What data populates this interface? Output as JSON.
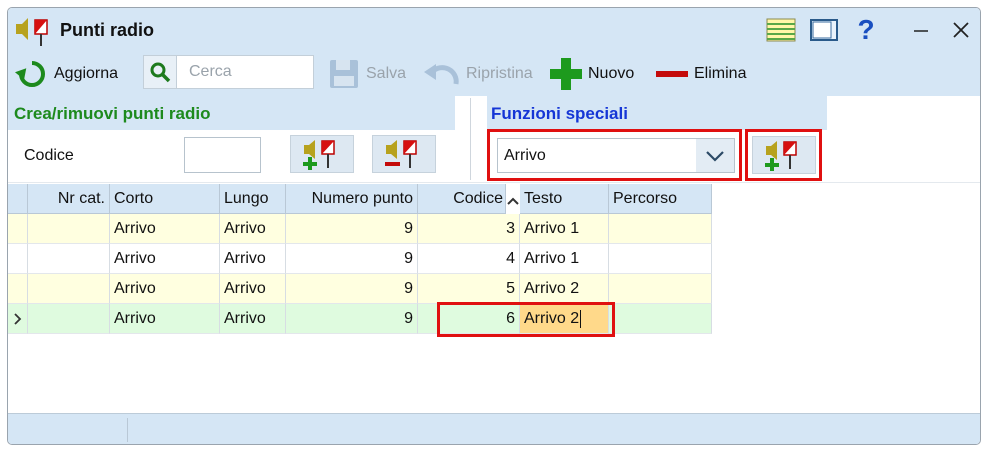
{
  "window": {
    "title": "Punti radio"
  },
  "titlebar_buttons": [
    {
      "name": "grid-view-icon"
    },
    {
      "name": "panel-view-icon"
    },
    {
      "name": "help-icon",
      "label": "?"
    },
    {
      "name": "minimize-icon",
      "label": "–"
    },
    {
      "name": "close-icon",
      "label": "✕"
    }
  ],
  "toolbar": {
    "refresh_label": "Aggiorna",
    "search_placeholder": "Cerca",
    "save_label": "Salva",
    "restore_label": "Ripristina",
    "new_label": "Nuovo",
    "delete_label": "Elimina"
  },
  "left_panel": {
    "title": "Crea/rimuovi punti radio",
    "codice_label": "Codice",
    "codice_value": ""
  },
  "right_panel": {
    "title": "Funzioni speciali",
    "combo_value": "Arrivo"
  },
  "table": {
    "columns": [
      "Nr cat.",
      "Corto",
      "Lungo",
      "Numero punto",
      "Codice",
      "Testo",
      "Percorso"
    ],
    "sort_column": "Codice",
    "rows": [
      {
        "nr_cat": "",
        "corto": "Arrivo",
        "lungo": "Arrivo",
        "numero_punto": "9",
        "codice": "3",
        "testo": "Arrivo 1",
        "percorso": ""
      },
      {
        "nr_cat": "",
        "corto": "Arrivo",
        "lungo": "Arrivo",
        "numero_punto": "9",
        "codice": "4",
        "testo": "Arrivo 1",
        "percorso": ""
      },
      {
        "nr_cat": "",
        "corto": "Arrivo",
        "lungo": "Arrivo",
        "numero_punto": "9",
        "codice": "5",
        "testo": "Arrivo 2",
        "percorso": ""
      },
      {
        "nr_cat": "",
        "corto": "Arrivo",
        "lungo": "Arrivo",
        "numero_punto": "9",
        "codice": "6",
        "testo": "Arrivo 2",
        "percorso": ""
      }
    ],
    "selected_row": 3
  },
  "colors": {
    "header_bg": "#d5e6f5",
    "row_alt": "#ffffe0",
    "row_selected": "#dffbdf",
    "edit_cell": "#ffd98a",
    "highlight_frame": "#e01010",
    "green_title": "#1d8a1d",
    "blue_title": "#1536d6"
  }
}
